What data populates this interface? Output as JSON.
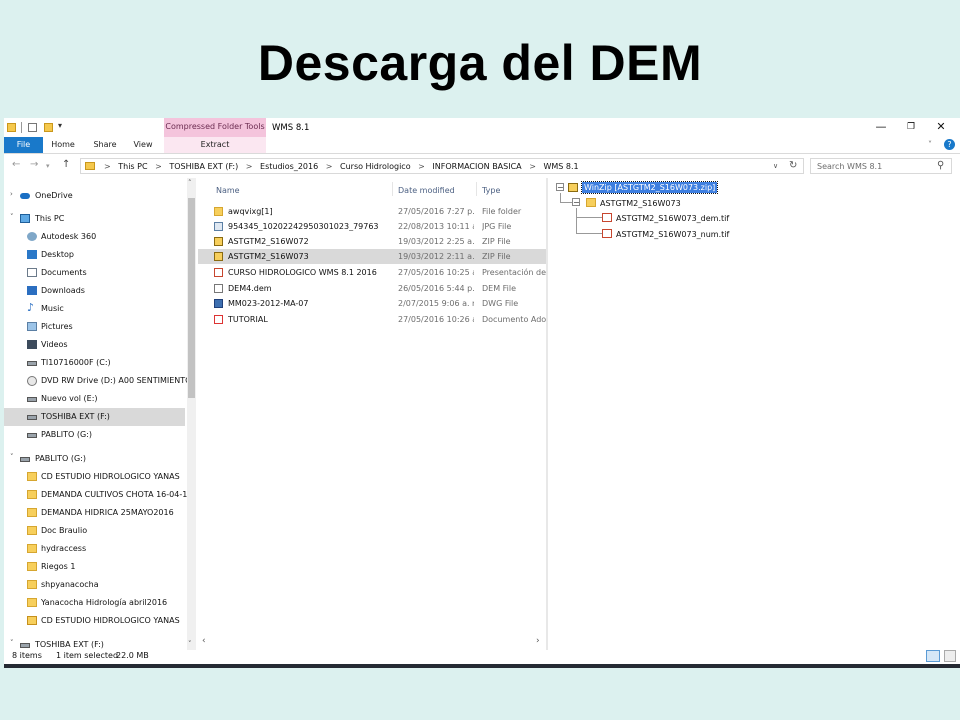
{
  "slide": {
    "title": "Descarga del DEM"
  },
  "window": {
    "title": "WMS 8.1",
    "context_tab_group": "Compressed Folder Tools",
    "tabs": [
      "File",
      "Home",
      "Share",
      "View",
      "Extract"
    ],
    "controls": {
      "minimize": "—",
      "maximize": "❐",
      "close": "✕"
    }
  },
  "address": {
    "crumbs": [
      "This PC",
      "TOSHIBA EXT (F:)",
      "Estudios_2016",
      "Curso Hidrologico",
      "INFORMACION BASICA",
      "WMS 8.1"
    ],
    "separator": ">",
    "search_placeholder": "Search WMS 8.1"
  },
  "nav": {
    "items": [
      {
        "label": "OneDrive",
        "icon": "cloud-icon"
      },
      {
        "label": "This PC",
        "icon": "computer-icon"
      },
      {
        "label": "Autodesk 360",
        "icon": "network-icon"
      },
      {
        "label": "Desktop",
        "icon": "desktop-icon"
      },
      {
        "label": "Documents",
        "icon": "documents-icon"
      },
      {
        "label": "Downloads",
        "icon": "downloads-icon"
      },
      {
        "label": "Music",
        "icon": "music-icon"
      },
      {
        "label": "Pictures",
        "icon": "pictures-icon"
      },
      {
        "label": "Videos",
        "icon": "videos-icon"
      },
      {
        "label": "TI10716000F (C:)",
        "icon": "drive-icon"
      },
      {
        "label": "DVD RW Drive (D:) A00 SENTIMIENTO",
        "icon": "dvd-icon"
      },
      {
        "label": "Nuevo vol (E:)",
        "icon": "drive-icon"
      },
      {
        "label": "TOSHIBA EXT (F:)",
        "icon": "drive-icon"
      },
      {
        "label": "PABLITO (G:)",
        "icon": "drive-icon"
      },
      {
        "label": "PABLITO (G:)",
        "icon": "drive-icon"
      },
      {
        "label": "CD ESTUDIO HIDROLOGICO YANAS",
        "icon": "folder-icon"
      },
      {
        "label": "DEMANDA CULTIVOS CHOTA 16-04-16",
        "icon": "folder-icon"
      },
      {
        "label": "DEMANDA HIDRICA 25MAYO2016",
        "icon": "folder-icon"
      },
      {
        "label": "Doc Braulio",
        "icon": "folder-icon"
      },
      {
        "label": "hydraccess",
        "icon": "folder-icon"
      },
      {
        "label": "Riegos 1",
        "icon": "folder-icon"
      },
      {
        "label": "shpyanacocha",
        "icon": "folder-icon"
      },
      {
        "label": "Yanacocha Hidrología abril2016",
        "icon": "folder-icon"
      },
      {
        "label": "CD ESTUDIO HIDROLOGICO YANAS",
        "icon": "zip-icon"
      },
      {
        "label": "TOSHIBA EXT (F:)",
        "icon": "drive-icon"
      }
    ]
  },
  "columns": {
    "name": "Name",
    "date": "Date modified",
    "type": "Type"
  },
  "files": [
    {
      "name": "awqvixg[1]",
      "date": "27/05/2016 7:27 p....",
      "type": "File folder",
      "icon": "folder-icon"
    },
    {
      "name": "954345_10202242950301023_797635178_n",
      "date": "22/08/2013 10:11 a...",
      "type": "JPG File",
      "icon": "image-icon"
    },
    {
      "name": "ASTGTM2_S16W072",
      "date": "19/03/2012 2:25 a. ...",
      "type": "ZIP File",
      "icon": "zip-icon"
    },
    {
      "name": "ASTGTM2_S16W073",
      "date": "19/03/2012 2:11 a. ...",
      "type": "ZIP File",
      "icon": "zip-icon"
    },
    {
      "name": "CURSO HIDROLOGICO WMS 8.1 2016",
      "date": "27/05/2016 10:25 a...",
      "type": "Presentación de ...",
      "icon": "powerpoint-icon"
    },
    {
      "name": "DEM4.dem",
      "date": "26/05/2016 5:44 p....",
      "type": "DEM File",
      "icon": "file-icon"
    },
    {
      "name": "MM023-2012-MA-07",
      "date": "2/07/2015 9:06 a. m.",
      "type": "DWG File",
      "icon": "dwg-icon"
    },
    {
      "name": "TUTORIAL",
      "date": "27/05/2016 10:26 a...",
      "type": "Documento Adob...",
      "icon": "pdf-icon"
    }
  ],
  "preview_tree": {
    "root": "WinZip [ASTGTM2_S16W073.zip]",
    "folder": "ASTGTM2_S16W073",
    "files": [
      "ASTGTM2_S16W073_dem.tif",
      "ASTGTM2_S16W073_num.tif"
    ]
  },
  "status": {
    "items": "8 items",
    "selected": "1 item selected",
    "size": "22.0 MB"
  }
}
